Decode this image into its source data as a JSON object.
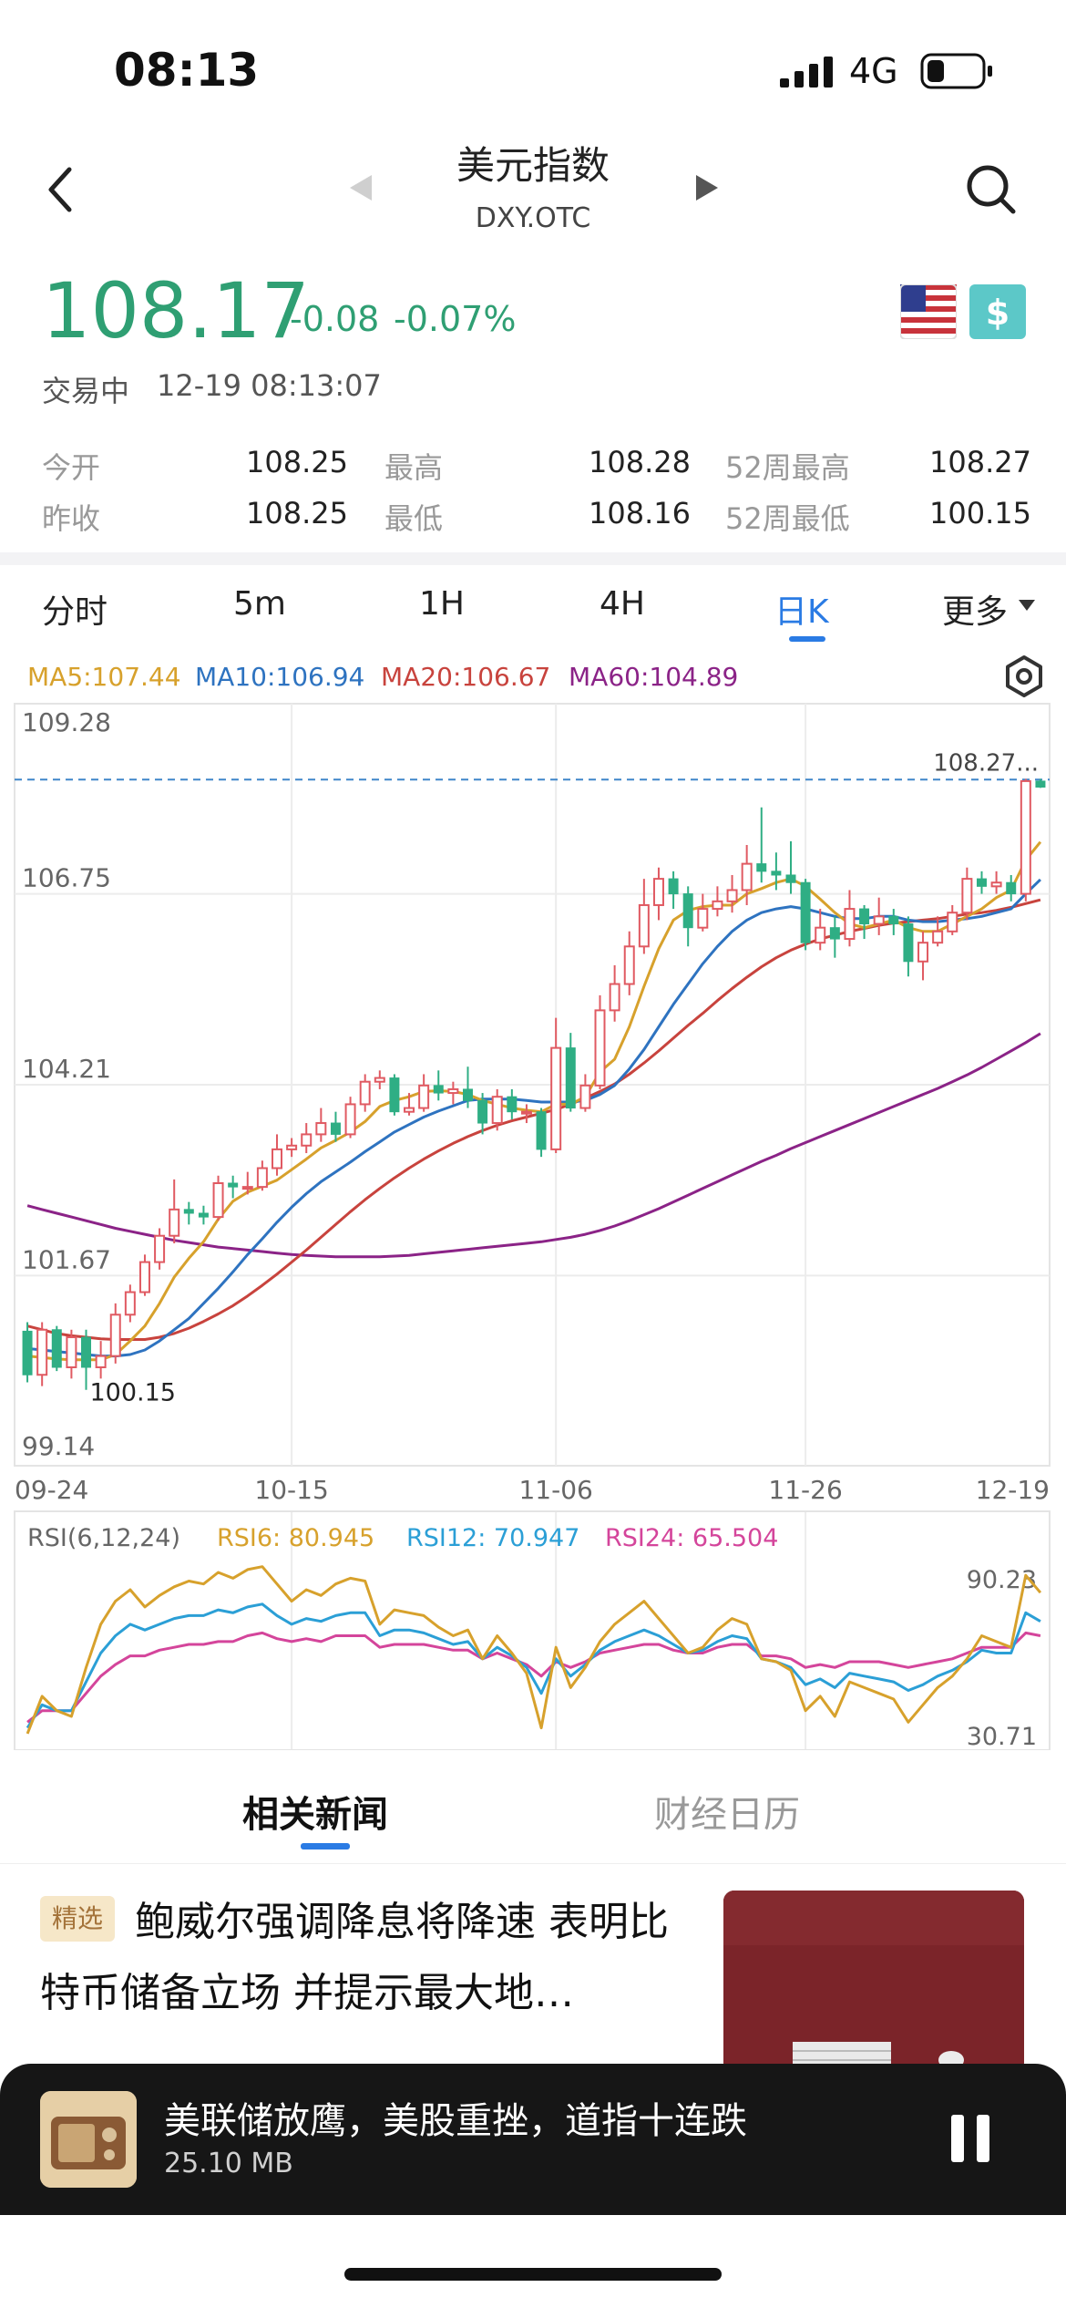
{
  "status_bar": {
    "time": "08:13",
    "network": "4G",
    "icons": [
      "signal-bars-icon",
      "battery-icon"
    ]
  },
  "header": {
    "title": "美元指数",
    "symbol": "DXY.OTC",
    "icons": [
      "back-chevron-icon",
      "prev-arrow-icon",
      "next-arrow-icon",
      "search-icon"
    ]
  },
  "quote": {
    "price": "108.17",
    "change": "-0.08",
    "change_pct": "-0.07%",
    "status": "交易中",
    "time": "12-19 08:13:07",
    "flags": [
      "us-flag-icon",
      "dollar-icon"
    ]
  },
  "stats": [
    {
      "label": "今开",
      "value": "108.25"
    },
    {
      "label": "最高",
      "value": "108.28"
    },
    {
      "label": "52周最高",
      "value": "108.27"
    },
    {
      "label": "昨收",
      "value": "108.25"
    },
    {
      "label": "最低",
      "value": "108.16"
    },
    {
      "label": "52周最低",
      "value": "100.15"
    }
  ],
  "tabs": {
    "t1": "分时",
    "t2": "5m",
    "t3": "1H",
    "t4": "4H",
    "t5": "日K",
    "t6": "更多",
    "active": "日K"
  },
  "ma_legend": {
    "ma5": "MA5:107.44",
    "ma10": "MA10:106.94",
    "ma20": "MA20:106.67",
    "ma60": "MA60:104.89"
  },
  "colors": {
    "up": "#e05a62",
    "down": "#2fae84",
    "ma5": "#d7a12c",
    "ma10": "#2e73c0",
    "ma20": "#c8433d",
    "ma60": "#8b2387",
    "accent": "#2a7be4"
  },
  "chart_data": {
    "type": "candlestick",
    "y_ticks": [
      "109.28",
      "106.75",
      "104.21",
      "101.67",
      "99.14"
    ],
    "ylim": [
      99.14,
      109.28
    ],
    "x_ticks": [
      "09-24",
      "10-15",
      "11-06",
      "11-26",
      "12-19"
    ],
    "last_price_label": "108.27...",
    "low_label": "100.15",
    "candles": [
      [
        100.93,
        100.35,
        101.05,
        100.25
      ],
      [
        100.35,
        100.95,
        101.05,
        100.2
      ],
      [
        100.95,
        100.45,
        101.0,
        100.4
      ],
      [
        100.45,
        100.85,
        100.95,
        100.3
      ],
      [
        100.85,
        100.45,
        100.95,
        100.15
      ],
      [
        100.45,
        100.6,
        100.8,
        100.3
      ],
      [
        100.6,
        101.15,
        101.3,
        100.5
      ],
      [
        101.15,
        101.45,
        101.55,
        101.05
      ],
      [
        101.45,
        101.85,
        101.95,
        101.4
      ],
      [
        101.85,
        102.2,
        102.3,
        101.75
      ],
      [
        102.2,
        102.55,
        102.95,
        102.1
      ],
      [
        102.55,
        102.5,
        102.65,
        102.35
      ],
      [
        102.5,
        102.45,
        102.6,
        102.35
      ],
      [
        102.45,
        102.9,
        103.0,
        102.4
      ],
      [
        102.9,
        102.85,
        103.0,
        102.7
      ],
      [
        102.85,
        102.85,
        103.05,
        102.75
      ],
      [
        102.85,
        103.1,
        103.2,
        102.8
      ],
      [
        103.1,
        103.35,
        103.55,
        103.0
      ],
      [
        103.35,
        103.4,
        103.5,
        103.25
      ],
      [
        103.4,
        103.55,
        103.7,
        103.3
      ],
      [
        103.55,
        103.7,
        103.9,
        103.45
      ],
      [
        103.7,
        103.55,
        103.85,
        103.45
      ],
      [
        103.55,
        103.95,
        104.05,
        103.5
      ],
      [
        103.95,
        104.25,
        104.35,
        103.85
      ],
      [
        104.25,
        104.3,
        104.4,
        104.15
      ],
      [
        104.3,
        103.85,
        104.35,
        103.8
      ],
      [
        103.85,
        103.9,
        104.1,
        103.8
      ],
      [
        103.9,
        104.2,
        104.35,
        103.85
      ],
      [
        104.2,
        104.1,
        104.4,
        104.0
      ],
      [
        104.1,
        104.15,
        104.25,
        103.95
      ],
      [
        104.15,
        104.0,
        104.45,
        103.9
      ],
      [
        104.0,
        103.7,
        104.1,
        103.55
      ],
      [
        103.7,
        104.05,
        104.15,
        103.6
      ],
      [
        104.05,
        103.85,
        104.15,
        103.75
      ],
      [
        103.85,
        103.85,
        103.95,
        103.7
      ],
      [
        103.85,
        103.35,
        103.9,
        103.25
      ],
      [
        103.35,
        104.7,
        105.1,
        103.3
      ],
      [
        104.7,
        103.9,
        104.9,
        103.85
      ],
      [
        103.9,
        104.2,
        104.35,
        103.85
      ],
      [
        104.2,
        105.2,
        105.4,
        104.15
      ],
      [
        105.2,
        105.55,
        105.8,
        105.05
      ],
      [
        105.55,
        106.05,
        106.25,
        105.4
      ],
      [
        106.05,
        106.6,
        106.95,
        105.95
      ],
      [
        106.6,
        106.95,
        107.1,
        106.4
      ],
      [
        106.95,
        106.75,
        107.05,
        106.55
      ],
      [
        106.75,
        106.3,
        106.85,
        106.05
      ],
      [
        106.3,
        106.55,
        106.75,
        106.25
      ],
      [
        106.55,
        106.65,
        106.85,
        106.45
      ],
      [
        106.65,
        106.8,
        107.0,
        106.5
      ],
      [
        106.8,
        107.15,
        107.4,
        106.6
      ],
      [
        107.15,
        107.05,
        107.9,
        106.9
      ],
      [
        107.05,
        107.0,
        107.3,
        106.8
      ],
      [
        107.0,
        106.9,
        107.45,
        106.75
      ],
      [
        106.9,
        106.1,
        106.95,
        106.0
      ],
      [
        106.1,
        106.3,
        106.55,
        106.0
      ],
      [
        106.3,
        106.15,
        106.45,
        105.9
      ],
      [
        106.15,
        106.55,
        106.8,
        106.05
      ],
      [
        106.55,
        106.35,
        106.6,
        106.15
      ],
      [
        106.35,
        106.45,
        106.7,
        106.2
      ],
      [
        106.45,
        106.35,
        106.55,
        106.2
      ],
      [
        106.35,
        105.85,
        106.45,
        105.65
      ],
      [
        105.85,
        106.1,
        106.25,
        105.6
      ],
      [
        106.1,
        106.25,
        106.45,
        106.05
      ],
      [
        106.25,
        106.5,
        106.6,
        106.2
      ],
      [
        106.5,
        106.95,
        107.1,
        106.4
      ],
      [
        106.95,
        106.85,
        107.05,
        106.75
      ],
      [
        106.85,
        106.9,
        107.05,
        106.75
      ],
      [
        106.9,
        106.75,
        107.0,
        106.65
      ],
      [
        106.75,
        108.25,
        108.28,
        106.65
      ],
      [
        108.25,
        108.17,
        108.28,
        108.16
      ]
    ],
    "ma5": [
      100.6,
      100.58,
      100.56,
      100.55,
      100.55,
      100.55,
      100.62,
      100.8,
      101.0,
      101.3,
      101.65,
      101.9,
      102.12,
      102.42,
      102.66,
      102.78,
      102.86,
      102.94,
      103.08,
      103.22,
      103.37,
      103.47,
      103.58,
      103.72,
      103.92,
      104.0,
      104.05,
      104.12,
      104.13,
      104.12,
      104.08,
      104.0,
      103.95,
      103.9,
      103.87,
      103.85,
      103.95,
      103.95,
      104.05,
      104.38,
      104.55,
      104.98,
      105.52,
      106.02,
      106.4,
      106.53,
      106.58,
      106.6,
      106.6,
      106.75,
      106.82,
      106.9,
      106.95,
      106.85,
      106.68,
      106.5,
      106.35,
      106.3,
      106.35,
      106.4,
      106.3,
      106.25,
      106.25,
      106.35,
      106.45,
      106.55,
      106.7,
      106.8,
      107.2,
      107.44
    ],
    "ma10": [
      100.7,
      100.68,
      100.66,
      100.64,
      100.62,
      100.6,
      100.6,
      100.62,
      100.68,
      100.8,
      100.95,
      101.1,
      101.3,
      101.5,
      101.72,
      101.95,
      102.16,
      102.38,
      102.58,
      102.76,
      102.92,
      103.05,
      103.18,
      103.32,
      103.45,
      103.58,
      103.68,
      103.78,
      103.86,
      103.93,
      104.0,
      104.02,
      104.02,
      104.02,
      104.0,
      103.98,
      103.98,
      103.98,
      104.0,
      104.08,
      104.2,
      104.42,
      104.68,
      104.98,
      105.28,
      105.55,
      105.82,
      106.05,
      106.25,
      106.4,
      106.5,
      106.55,
      106.58,
      106.55,
      106.5,
      106.45,
      106.42,
      106.42,
      106.45,
      106.45,
      106.4,
      106.38,
      106.38,
      106.4,
      106.42,
      106.45,
      106.5,
      106.55,
      106.75,
      106.94
    ],
    "ma20": [
      101.0,
      100.95,
      100.9,
      100.87,
      100.85,
      100.83,
      100.82,
      100.82,
      100.82,
      100.85,
      100.9,
      100.97,
      101.06,
      101.16,
      101.27,
      101.4,
      101.54,
      101.69,
      101.85,
      102.01,
      102.18,
      102.35,
      102.52,
      102.68,
      102.83,
      102.97,
      103.1,
      103.22,
      103.33,
      103.43,
      103.52,
      103.6,
      103.67,
      103.73,
      103.78,
      103.83,
      103.88,
      103.95,
      104.03,
      104.12,
      104.22,
      104.35,
      104.5,
      104.66,
      104.83,
      105.0,
      105.16,
      105.33,
      105.49,
      105.64,
      105.78,
      105.9,
      106.0,
      106.08,
      106.15,
      106.2,
      106.25,
      106.29,
      106.33,
      106.36,
      106.38,
      106.4,
      106.42,
      106.45,
      106.48,
      106.5,
      106.53,
      106.57,
      106.62,
      106.67
    ],
    "ma60": [
      102.6,
      102.55,
      102.5,
      102.45,
      102.4,
      102.35,
      102.3,
      102.26,
      102.22,
      102.18,
      102.14,
      102.11,
      102.08,
      102.05,
      102.03,
      102.01,
      101.99,
      101.97,
      101.95,
      101.94,
      101.93,
      101.92,
      101.92,
      101.92,
      101.92,
      101.93,
      101.94,
      101.96,
      101.98,
      102.0,
      102.02,
      102.04,
      102.06,
      102.08,
      102.1,
      102.12,
      102.15,
      102.18,
      102.22,
      102.27,
      102.33,
      102.4,
      102.48,
      102.56,
      102.65,
      102.74,
      102.83,
      102.92,
      103.01,
      103.1,
      103.19,
      103.27,
      103.36,
      103.44,
      103.52,
      103.6,
      103.68,
      103.76,
      103.84,
      103.92,
      104.0,
      104.08,
      104.16,
      104.25,
      104.34,
      104.44,
      104.55,
      104.66,
      104.77,
      104.89
    ]
  },
  "rsi": {
    "label": "RSI(6,12,24)",
    "rsi6": "RSI6: 80.945",
    "rsi12": "RSI12: 70.947",
    "rsi24": "RSI24: 65.504",
    "top": "90.23",
    "bottom": "30.71",
    "range": [
      30.71,
      90.23
    ],
    "series6": [
      32,
      45,
      40,
      38,
      55,
      70,
      78,
      82,
      76,
      80,
      83,
      85,
      84,
      88,
      86,
      89,
      90,
      84,
      78,
      82,
      80,
      84,
      86,
      85,
      70,
      75,
      74,
      73,
      69,
      66,
      68,
      58,
      66,
      60,
      53,
      34,
      62,
      48,
      55,
      64,
      70,
      74,
      78,
      72,
      66,
      60,
      62,
      68,
      72,
      70,
      58,
      57,
      54,
      40,
      45,
      38,
      50,
      48,
      46,
      44,
      36,
      42,
      48,
      52,
      58,
      66,
      64,
      62,
      87,
      81
    ],
    "series12": [
      34,
      42,
      40,
      40,
      50,
      60,
      66,
      70,
      68,
      70,
      72,
      73,
      73,
      75,
      74,
      76,
      77,
      73,
      70,
      72,
      71,
      73,
      74,
      74,
      66,
      68,
      68,
      67,
      65,
      63,
      64,
      58,
      62,
      59,
      55,
      46,
      58,
      52,
      56,
      61,
      64,
      66,
      68,
      66,
      63,
      60,
      61,
      64,
      66,
      65,
      58,
      57,
      55,
      49,
      51,
      48,
      53,
      52,
      51,
      50,
      47,
      49,
      52,
      54,
      57,
      61,
      60,
      60,
      74,
      71
    ],
    "series24": [
      36,
      40,
      40,
      40,
      46,
      52,
      56,
      59,
      59,
      61,
      62,
      63,
      63,
      64,
      64,
      66,
      67,
      65,
      64,
      65,
      64,
      66,
      66,
      66,
      62,
      63,
      63,
      63,
      62,
      61,
      61,
      58,
      60,
      58,
      56,
      52,
      57,
      55,
      57,
      60,
      61,
      62,
      63,
      63,
      61,
      60,
      60,
      62,
      63,
      63,
      59,
      59,
      58,
      55,
      56,
      55,
      57,
      57,
      57,
      56,
      55,
      56,
      57,
      58,
      60,
      62,
      62,
      62,
      67,
      66
    ]
  },
  "news": {
    "tab_related": "相关新闻",
    "tab_calendar": "财经日历",
    "badge": "精选",
    "headline": "鲍威尔强调降息将降速 表明比特币储备立场 并提示最大地…"
  },
  "player": {
    "title": "美联储放鹰，美股重挫，道指十连跌",
    "size": "25.10 MB",
    "icons": [
      "radio-art-icon",
      "pause-icon"
    ]
  }
}
